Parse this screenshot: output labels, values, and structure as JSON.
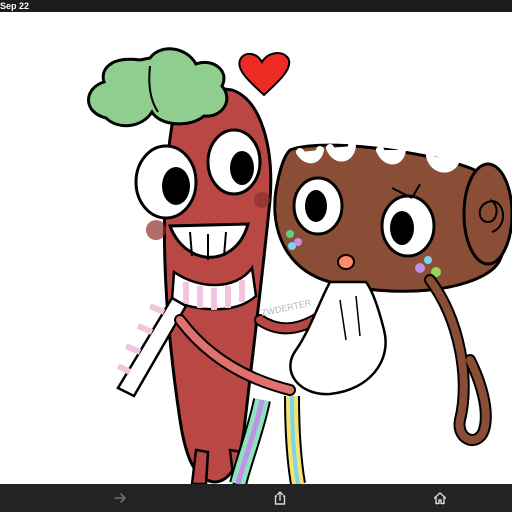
{
  "status_bar": {
    "date": "Sep 22"
  },
  "artwork": {
    "watermark": "ZWDERTER",
    "colors": {
      "carrot": "#b94845",
      "leaf": "#8fce8e",
      "log": "#8a4d36",
      "heart": "#ee2a24",
      "scarf_stripe": "#f3c4de",
      "glove": "#ffffff"
    }
  },
  "toolbar": {
    "forward": {
      "icon": "arrow-right-icon",
      "enabled": false
    },
    "share": {
      "icon": "share-icon"
    },
    "home": {
      "icon": "home-icon"
    }
  }
}
